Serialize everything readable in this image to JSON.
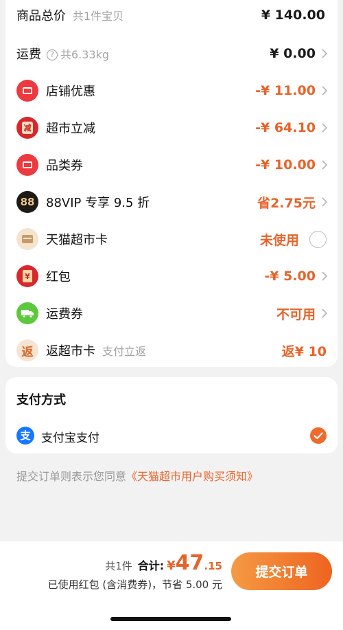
{
  "summary": {
    "items_total": {
      "label": "商品总价",
      "sub": "共1件宝贝",
      "value": "¥ 140.00"
    },
    "shipping": {
      "label": "运费",
      "sub": "共6.33kg",
      "value": "¥ 0.00"
    },
    "store_discount": {
      "label": "店铺优惠",
      "value": "-¥ 11.00"
    },
    "market_reduce": {
      "label": "超市立减",
      "value": "-¥ 64.10",
      "icon_char": "减"
    },
    "category_coupon": {
      "label": "品类券",
      "value": "-¥ 10.00"
    },
    "vip": {
      "label": "88VIP 专享 9.5 折",
      "value": "省2.75元",
      "icon_text": "88"
    },
    "market_card": {
      "label": "天猫超市卡",
      "value": "未使用"
    },
    "red_packet": {
      "label": "红包",
      "value": "-¥ 5.00",
      "icon_char": "¥"
    },
    "shipping_coupon": {
      "label": "运费券",
      "value": "不可用"
    },
    "rebate_card": {
      "label": "返超市卡",
      "sub": "支付立返",
      "value": "返¥ 10",
      "icon_char": "返"
    }
  },
  "payment": {
    "title": "支付方式",
    "method": "支付宝支付",
    "alipay_icon_char": "支"
  },
  "agreement": {
    "prefix": "提交订单则表示您同意",
    "link": "《天猫超市用户购买须知》"
  },
  "bottom": {
    "count": "共1件",
    "total_label": "合计:",
    "currency": "¥",
    "amount_int": "47",
    "amount_dec": ".15",
    "saved_text": "已使用红包 (含消费券)，节省 5.00 元",
    "submit_label": "提交订单"
  },
  "colors": {
    "accent": "#e8632a",
    "button_start": "#f59a44",
    "button_end": "#ee6420",
    "alipay_blue": "#1677ff",
    "red_icon": "#ec3a3f",
    "green_icon": "#5cc83c"
  },
  "icons": {
    "help": "question-circle-icon",
    "coupon": "ticket-icon",
    "vip": "88vip-icon",
    "card": "card-icon",
    "red_packet": "red-packet-icon",
    "truck": "truck-icon",
    "rebate": "rebate-icon",
    "chevron": "chevron-right-icon",
    "alipay": "alipay-icon",
    "check": "check-circle-icon"
  }
}
